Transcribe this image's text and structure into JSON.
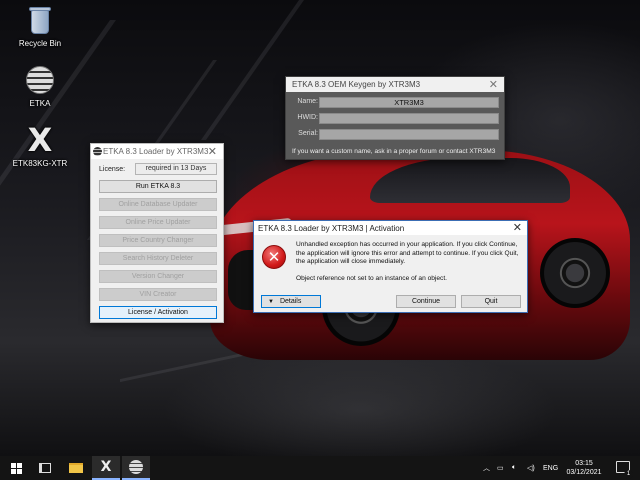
{
  "desktop": {
    "icons": [
      {
        "label": "Recycle Bin",
        "icon": "recycle-bin-icon"
      },
      {
        "label": "ETKA",
        "icon": "etka-app-icon"
      },
      {
        "label": "ETK83KG-XTR",
        "icon": "x-keygen-icon"
      }
    ]
  },
  "keygen": {
    "title": "ETKA 8.3 OEM Keygen by XTR3M3",
    "name_label": "Name:",
    "name_value": "XTR3M3",
    "hwid_label": "HWID:",
    "hwid_value": "",
    "serial_label": "Serial:",
    "serial_value": "",
    "note": "If you want a custom name, ask in a proper forum or contact XTR3M3"
  },
  "loader": {
    "title": "ETKA 8.3 Loader by XTR3M3",
    "license_label": "License:",
    "license_value": "required in 13 Days",
    "buttons": [
      {
        "label": "Run ETKA 8.3",
        "enabled": true
      },
      {
        "label": "Online Database Updater",
        "enabled": false
      },
      {
        "label": "Online Price Updater",
        "enabled": false
      },
      {
        "label": "Price Country Changer",
        "enabled": false
      },
      {
        "label": "Search History Deleter",
        "enabled": false
      },
      {
        "label": "Version Changer",
        "enabled": false
      },
      {
        "label": "VIN Creator",
        "enabled": false
      },
      {
        "label": "License / Activation",
        "enabled": true
      }
    ]
  },
  "dialog": {
    "title": "ETKA 8.3 Loader by XTR3M3 | Activation",
    "message": "Unhandled exception has occurred in your application. If you click Continue, the application will ignore this error and attempt to continue. If you click Quit, the application will close immediately.",
    "detail": "Object reference not set to an instance of an object.",
    "details_label": "Details",
    "continue_label": "Continue",
    "quit_label": "Quit"
  },
  "taskbar": {
    "language": "ENG",
    "time": "03:15",
    "date": "03/12/2021",
    "notification_count": "1"
  },
  "colors": {
    "accent": "#0078d7",
    "error_red": "#d11a1a",
    "car_red": "#b8141b"
  }
}
